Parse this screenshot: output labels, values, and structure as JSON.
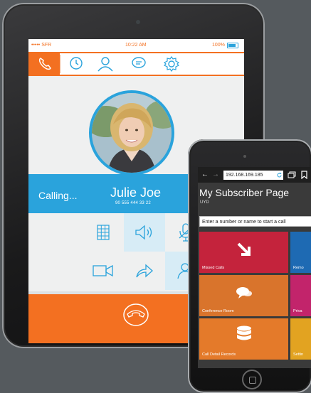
{
  "tablet": {
    "status": {
      "carrier": "••••• SFR",
      "time": "10:22 AM",
      "battery": "100%"
    },
    "nav_icons": [
      "phone-icon",
      "clock-icon",
      "user-icon",
      "chat-icon",
      "gear-icon"
    ],
    "call": {
      "status": "Calling...",
      "name": "Julie Joe",
      "number": "90 555 444 33 22"
    },
    "controls": [
      "keypad-icon",
      "speaker-icon",
      "mute-mic-icon",
      "video-icon",
      "transfer-icon",
      "add-user-icon"
    ],
    "colors": {
      "accent": "#f37021",
      "blue": "#2aa3dc"
    }
  },
  "phone": {
    "url": "192.168.169.185",
    "title": "My Subscriber Page",
    "subtitle": "UYD",
    "input_placeholder": "Enter a number or name to start a call",
    "tiles": [
      {
        "label": "Missed Calls",
        "color": "#c4233c",
        "icon": "arrow-down-right-icon"
      },
      {
        "label": "Remo",
        "color": "#1e6ab3",
        "icon": ""
      },
      {
        "label": "Conference Room",
        "color": "#d9742c",
        "icon": "chat-bubbles-icon"
      },
      {
        "label": "Priva",
        "color": "#c2246b",
        "icon": ""
      },
      {
        "label": "Call Detail Records",
        "color": "#e47a2a",
        "icon": "database-icon"
      },
      {
        "label": "Settin",
        "color": "#e2a321",
        "icon": ""
      }
    ]
  }
}
